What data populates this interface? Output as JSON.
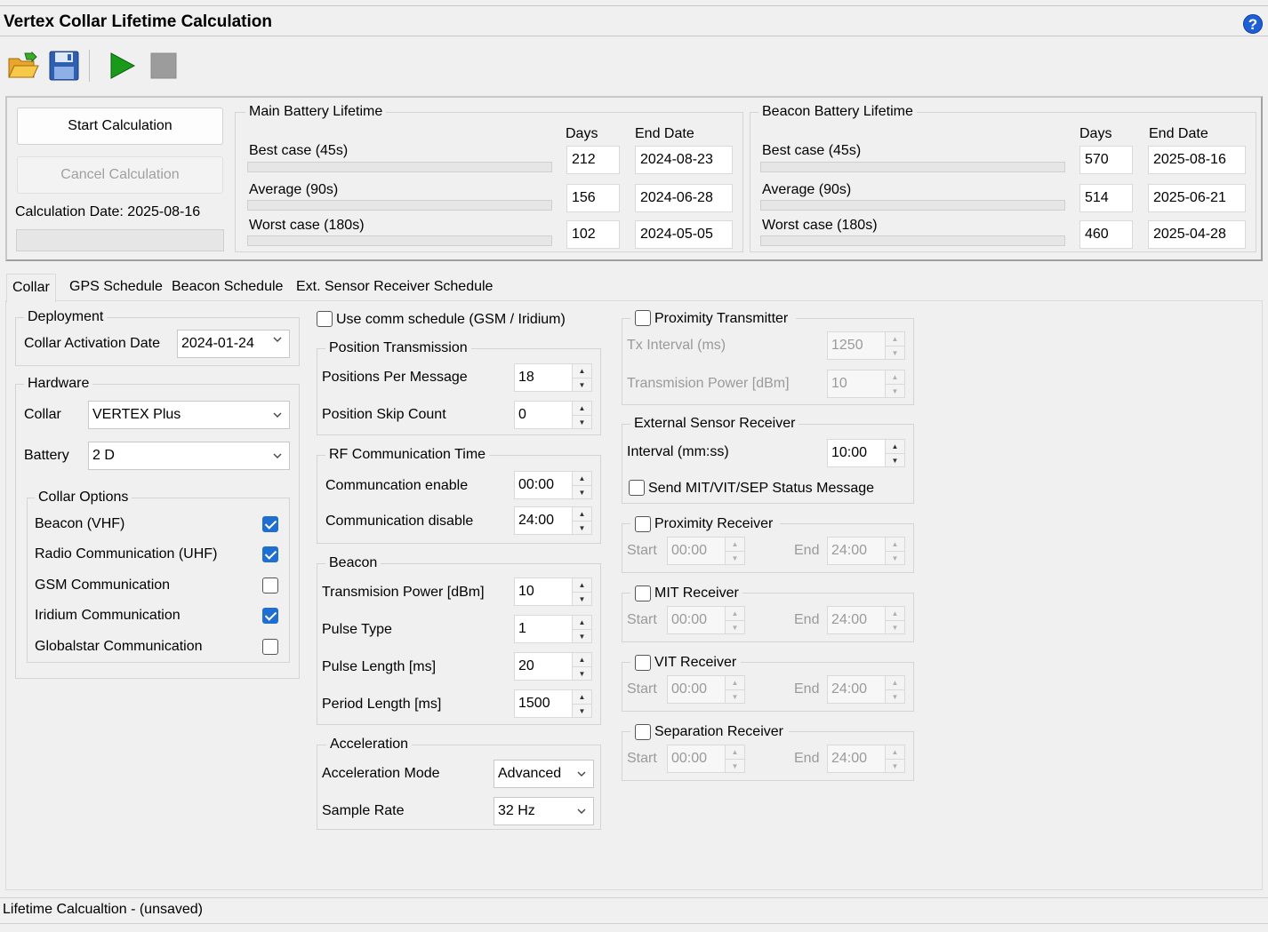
{
  "window": {
    "title": "Vertex Collar Lifetime Calculation"
  },
  "toolbar": {
    "icons": [
      "open-folder-icon",
      "save-icon",
      "play-icon",
      "stop-icon"
    ]
  },
  "calc": {
    "start_label": "Start Calculation",
    "cancel_label": "Cancel Calculation",
    "date_label": "Calculation Date: 2025-08-16"
  },
  "main_battery": {
    "title": "Main Battery Lifetime",
    "days_header": "Days",
    "end_header": "End Date",
    "rows": [
      {
        "label": "Best case (45s)",
        "days": "212",
        "end": "2024-08-23"
      },
      {
        "label": "Average (90s)",
        "days": "156",
        "end": "2024-06-28"
      },
      {
        "label": "Worst case (180s)",
        "days": "102",
        "end": "2024-05-05"
      }
    ]
  },
  "beacon_battery": {
    "title": "Beacon Battery Lifetime",
    "days_header": "Days",
    "end_header": "End Date",
    "rows": [
      {
        "label": "Best case (45s)",
        "days": "570",
        "end": "2025-08-16"
      },
      {
        "label": "Average (90s)",
        "days": "514",
        "end": "2025-06-21"
      },
      {
        "label": "Worst case (180s)",
        "days": "460",
        "end": "2025-04-28"
      }
    ]
  },
  "tabs": [
    {
      "label": "Collar"
    },
    {
      "label": "GPS Schedule"
    },
    {
      "label": "Beacon Schedule"
    },
    {
      "label": "Ext. Sensor Receiver Schedule"
    }
  ],
  "deployment": {
    "title": "Deployment",
    "activation_label": "Collar Activation Date",
    "activation_value": "2024-01-24"
  },
  "hardware": {
    "title": "Hardware",
    "collar_label": "Collar",
    "collar_value": "VERTEX Plus",
    "battery_label": "Battery",
    "battery_value": "2 D",
    "options_title": "Collar Options",
    "options": [
      {
        "label": "Beacon (VHF)",
        "checked": true
      },
      {
        "label": "Radio Communication (UHF)",
        "checked": true
      },
      {
        "label": "GSM Communication",
        "checked": false
      },
      {
        "label": "Iridium Communication",
        "checked": true
      },
      {
        "label": "Globalstar Communication",
        "checked": false
      }
    ]
  },
  "comm": {
    "use_schedule_label": "Use comm schedule (GSM / Iridium)",
    "position_title": "Position Transmission",
    "positions_per_message_label": "Positions Per Message",
    "positions_per_message": "18",
    "skip_count_label": "Position Skip Count",
    "skip_count": "0",
    "rf_title": "RF Communication Time",
    "enable_label": "Communcation enable",
    "enable_value": "00:00",
    "disable_label": "Communication disable",
    "disable_value": "24:00"
  },
  "beacon": {
    "title": "Beacon",
    "power_label": "Transmision Power [dBm]",
    "power": "10",
    "pulse_type_label": "Pulse Type",
    "pulse_type": "1",
    "pulse_length_label": "Pulse Length [ms]",
    "pulse_length": "20",
    "period_label": "Period Length [ms]",
    "period": "1500"
  },
  "acceleration": {
    "title": "Acceleration",
    "mode_label": "Acceleration Mode",
    "mode": "Advanced",
    "rate_label": "Sample Rate",
    "rate": "32 Hz"
  },
  "proximity_tx": {
    "title": "Proximity Transmitter",
    "interval_label": "Tx Interval (ms)",
    "interval": "1250",
    "power_label": "Transmision Power [dBm]",
    "power": "10"
  },
  "ext_sensor": {
    "title": "External Sensor Receiver",
    "interval_label": "Interval (mm:ss)",
    "interval": "10:00",
    "status_label": "Send MIT/VIT/SEP Status Message"
  },
  "receivers": [
    {
      "title": "Proximity Receiver",
      "start_label": "Start",
      "start": "00:00",
      "end_label": "End",
      "end": "24:00"
    },
    {
      "title": "MIT Receiver",
      "start_label": "Start",
      "start": "00:00",
      "end_label": "End",
      "end": "24:00"
    },
    {
      "title": "VIT Receiver",
      "start_label": "Start",
      "start": "00:00",
      "end_label": "End",
      "end": "24:00"
    },
    {
      "title": "Separation Receiver",
      "start_label": "Start",
      "start": "00:00",
      "end_label": "End",
      "end": "24:00"
    }
  ],
  "status": {
    "text": "Lifetime Calcualtion - (unsaved)"
  },
  "colors": {
    "accent": "#1f6fd1",
    "play": "#1a9a1a"
  }
}
